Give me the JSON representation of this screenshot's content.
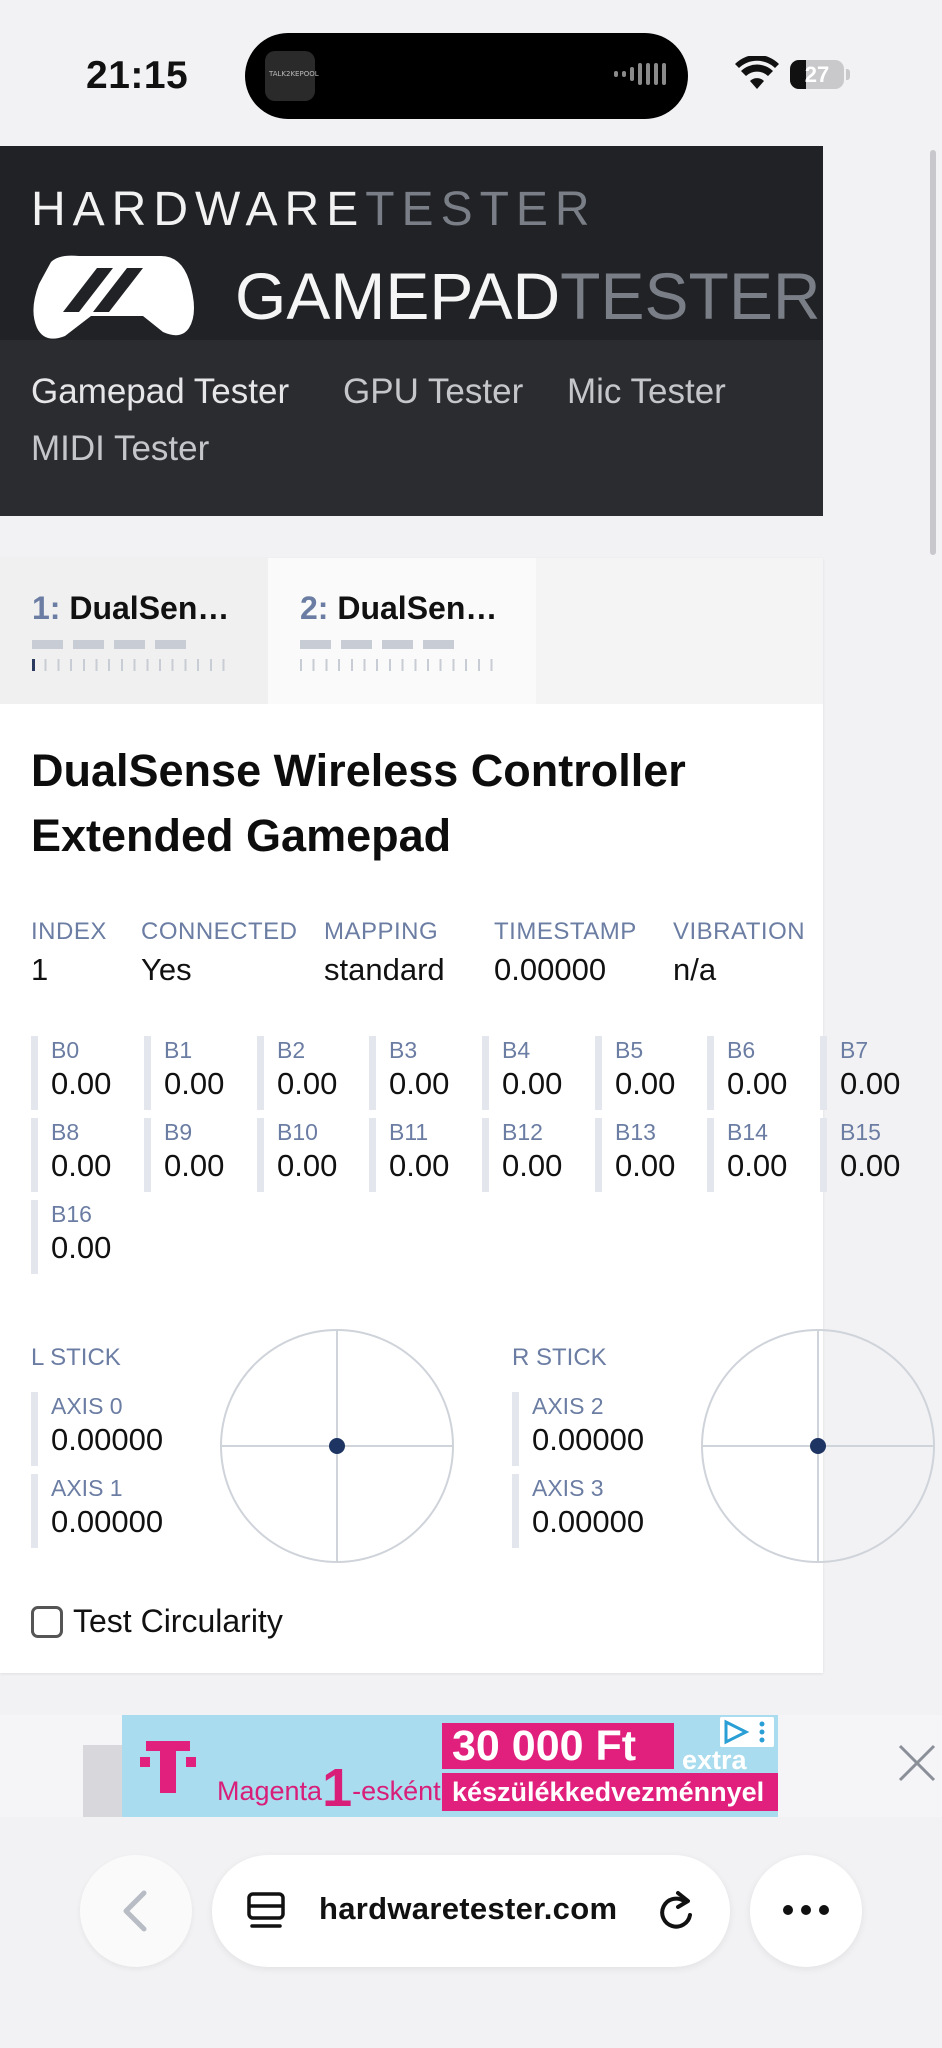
{
  "status_bar": {
    "time": "21:15",
    "battery": "27",
    "island_app": "TALK2KEPOOL"
  },
  "header": {
    "brand_top_a": "HARDWARE",
    "brand_top_b": "TESTER",
    "brand_main_a": "GAMEPAD",
    "brand_main_b": "TESTER",
    "nav": [
      "Gamepad Tester",
      "GPU Tester",
      "Mic Tester",
      "MIDI Tester"
    ]
  },
  "tabs": [
    {
      "num": "1:",
      "name": "DualSen…"
    },
    {
      "num": "2:",
      "name": "DualSen…"
    }
  ],
  "gamepad": {
    "title": "DualSense Wireless Controller Extended Gamepad",
    "meta": [
      {
        "key": "INDEX",
        "value": "1"
      },
      {
        "key": "CONNECTED",
        "value": "Yes"
      },
      {
        "key": "MAPPING",
        "value": "standard"
      },
      {
        "key": "TIMESTAMP",
        "value": "0.00000"
      },
      {
        "key": "VIBRATION",
        "value": "n/a"
      }
    ],
    "buttons": [
      {
        "key": "B0",
        "value": "0.00"
      },
      {
        "key": "B1",
        "value": "0.00"
      },
      {
        "key": "B2",
        "value": "0.00"
      },
      {
        "key": "B3",
        "value": "0.00"
      },
      {
        "key": "B4",
        "value": "0.00"
      },
      {
        "key": "B5",
        "value": "0.00"
      },
      {
        "key": "B6",
        "value": "0.00"
      },
      {
        "key": "B7",
        "value": "0.00"
      },
      {
        "key": "B8",
        "value": "0.00"
      },
      {
        "key": "B9",
        "value": "0.00"
      },
      {
        "key": "B10",
        "value": "0.00"
      },
      {
        "key": "B11",
        "value": "0.00"
      },
      {
        "key": "B12",
        "value": "0.00"
      },
      {
        "key": "B13",
        "value": "0.00"
      },
      {
        "key": "B14",
        "value": "0.00"
      },
      {
        "key": "B15",
        "value": "0.00"
      },
      {
        "key": "B16",
        "value": "0.00"
      }
    ],
    "l_stick": {
      "label": "L STICK",
      "axes": [
        {
          "key": "AXIS 0",
          "value": "0.00000"
        },
        {
          "key": "AXIS 1",
          "value": "0.00000"
        }
      ],
      "x": 0,
      "y": 0
    },
    "r_stick": {
      "label": "R STICK",
      "axes": [
        {
          "key": "AXIS 2",
          "value": "0.00000"
        },
        {
          "key": "AXIS 3",
          "value": "0.00000"
        }
      ],
      "x": 0,
      "y": 0
    },
    "circularity_label": "Test Circularity",
    "circularity_checked": false
  },
  "ad": {
    "brand": "Magenta",
    "brand_num": "1",
    "brand_suffix": "-esként",
    "price": "30 000 Ft",
    "extra": "extra",
    "sub": "készülékkedvezménnyel",
    "accent": "#e11f7d"
  },
  "browser": {
    "url": "hardwaretester.com"
  }
}
